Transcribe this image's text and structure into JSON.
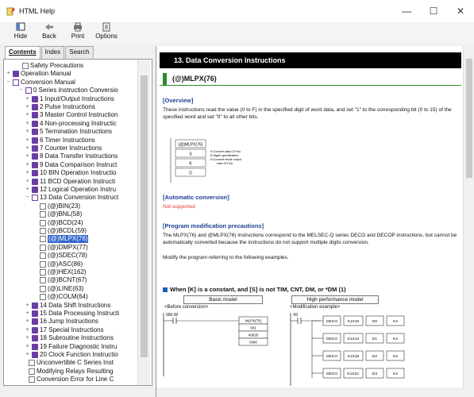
{
  "window": {
    "title": "HTML Help",
    "minimize": "—",
    "maximize": "☐",
    "close": "✕"
  },
  "toolbar": [
    {
      "label": "Hide",
      "icon": "hide-icon"
    },
    {
      "label": "Back",
      "icon": "back-icon"
    },
    {
      "label": "Print",
      "icon": "print-icon"
    },
    {
      "label": "Options",
      "icon": "options-icon"
    }
  ],
  "tabs": [
    "Contents",
    "Index",
    "Search"
  ],
  "tree": [
    {
      "label": "Safety Precautions",
      "icon": "page",
      "pm": ""
    },
    {
      "label": "Operation Manual",
      "icon": "book",
      "pm": "+"
    },
    {
      "label": "Conversion Manual",
      "icon": "openbook",
      "pm": "−"
    },
    {
      "label": "0 Series Instruction Conversio",
      "icon": "openbook",
      "pm": "−"
    },
    {
      "label": "1 Input/Output Instructions",
      "icon": "book",
      "pm": "+"
    },
    {
      "label": "2 Pulse Instructions",
      "icon": "book",
      "pm": "+"
    },
    {
      "label": "3 Master Control Instruction",
      "icon": "book",
      "pm": "+"
    },
    {
      "label": "4 Non-processing Instructic",
      "icon": "book",
      "pm": "+"
    },
    {
      "label": "5 Termination Instructions",
      "icon": "book",
      "pm": "+"
    },
    {
      "label": "6 Timer Instructions",
      "icon": "book",
      "pm": "+"
    },
    {
      "label": "7 Counter Instructions",
      "icon": "book",
      "pm": "+"
    },
    {
      "label": "8 Data Transfer Instructions",
      "icon": "book",
      "pm": "+"
    },
    {
      "label": "9 Data Comparison Instruct",
      "icon": "book",
      "pm": "+"
    },
    {
      "label": "10 BIN Operation Instructio",
      "icon": "book",
      "pm": "+"
    },
    {
      "label": "11 BCD Operation Instructi",
      "icon": "book",
      "pm": "+"
    },
    {
      "label": "12 Logical Operation Instru",
      "icon": "book",
      "pm": "+"
    },
    {
      "label": "13 Data Conversion Instruct",
      "icon": "openbook",
      "pm": "−"
    },
    {
      "label": "(@)BIN(23)",
      "icon": "page",
      "pm": ""
    },
    {
      "label": "(@)BNL(58)",
      "icon": "page",
      "pm": ""
    },
    {
      "label": "(@)BCD(24)",
      "icon": "page",
      "pm": ""
    },
    {
      "label": "(@)BCDL(59)",
      "icon": "page",
      "pm": ""
    },
    {
      "label": "(@)MLPX(76)",
      "icon": "page",
      "pm": "",
      "selected": true
    },
    {
      "label": "(@)DMPX(77)",
      "icon": "page",
      "pm": ""
    },
    {
      "label": "(@)SDEC(78)",
      "icon": "page",
      "pm": ""
    },
    {
      "label": "(@)ASC(86)",
      "icon": "page",
      "pm": ""
    },
    {
      "label": "(@)HEX(162)",
      "icon": "page",
      "pm": ""
    },
    {
      "label": "(@)BCNT(67)",
      "icon": "page",
      "pm": ""
    },
    {
      "label": "(@)LINE(63)",
      "icon": "page",
      "pm": ""
    },
    {
      "label": "(@)COLM(64)",
      "icon": "page",
      "pm": ""
    },
    {
      "label": "14 Data Shift Instructions",
      "icon": "book",
      "pm": "+"
    },
    {
      "label": "15 Data Processing Instructi",
      "icon": "book",
      "pm": "+"
    },
    {
      "label": "16 Jump Instructions",
      "icon": "book",
      "pm": "+"
    },
    {
      "label": "17 Special Instructions",
      "icon": "book",
      "pm": "+"
    },
    {
      "label": "18 Subroutine Instructions",
      "icon": "book",
      "pm": "+"
    },
    {
      "label": "19 Failure Diagnostic Instru",
      "icon": "book",
      "pm": "+"
    },
    {
      "label": "20 Clock Function Instructio",
      "icon": "book",
      "pm": "+"
    },
    {
      "label": "Unconvertible C Series Inst",
      "icon": "page",
      "pm": ""
    },
    {
      "label": "Modifying Relays Resulting",
      "icon": "page",
      "pm": ""
    },
    {
      "label": "Conversion Error for Line C",
      "icon": "page",
      "pm": ""
    }
  ],
  "doc": {
    "title": "13. Data Conversion Instructions",
    "section": "(@)MLPX(76)",
    "overview_head": "[Overview]",
    "overview_text": "These instructions read the value (0 to F) in the specified digit of word data, and set \"1\" to the corresponding bit (0 to 15) of the specified word and set \"0\" to all other bits.",
    "diagram": {
      "name": "(@)MLPX(76)",
      "operands": [
        "S",
        "K",
        "D"
      ],
      "notes": [
        "S:Convert data CH No.",
        "K:Digits specification",
        "D:Convert result output",
        "start CH No."
      ]
    },
    "auto_head": "[Automatic conversion]",
    "auto_text": "Not supported",
    "mod_head": "[Program modification precautions]",
    "mod_text1": "The MLPX(76) and @MLPX(76) instructions correspond to the MELSEC-Q series DECO and DECOP instructions, but cannot be automatically converted because the instructions do not support multiple digits conversion.",
    "mod_text2": "Modify the program referring to the following examples.",
    "case_title": "When [K] is a constant, and [S] is not TIM, CNT, DM, or *DM (1)",
    "basic_model": "Basic model",
    "high_model": "High performance model",
    "before": "<Before conversion>",
    "after": "<Modification example>",
    "contact": "000.00",
    "before_boxes": [
      "MLPX(76)",
      "001",
      "#0020",
      "DM0"
    ],
    "after_rows": [
      [
        "DECO",
        "K1X10",
        "D0",
        "K4"
      ],
      [
        "DECO",
        "K1X14",
        "D1",
        "K4"
      ],
      [
        "DECO",
        "K1X18",
        "D2",
        "K4"
      ],
      [
        "DECO",
        "K1X1C",
        "D3",
        "K4"
      ]
    ],
    "contact2": "X0"
  }
}
